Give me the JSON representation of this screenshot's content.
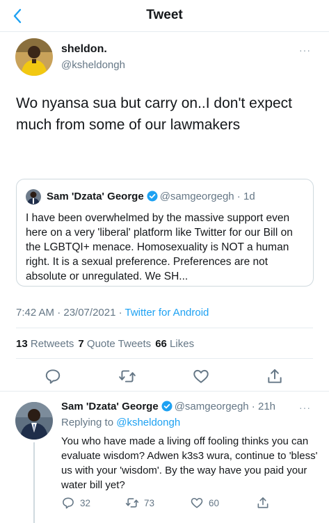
{
  "header": {
    "title": "Tweet"
  },
  "tweet": {
    "author_name": "sheldon.",
    "author_handle": "@ksheldongh",
    "text": "Wo nyansa sua but carry on..I don't expect much from some of our lawmakers",
    "timestamp": "7:42 AM · 23/07/2021 · ",
    "source": "Twitter for Android"
  },
  "quoted_tweet": {
    "author_name": "Sam 'Dzata' George",
    "author_handle": "@samgeorgegh · 1d",
    "text": "I have been overwhelmed by the massive support even here on a very 'liberal' platform like Twitter for our Bill on the LGBTQI+ menace. Homosexuality is NOT a human right. It is a sexual preference. Preferences are not absolute or unregulated. We SH..."
  },
  "stats": {
    "retweets_count": "13",
    "retweets_label": "Retweets",
    "quote_tweets_count": "7",
    "quote_tweets_label": "Quote Tweets",
    "likes_count": "66",
    "likes_label": "Likes"
  },
  "reply": {
    "author_name": "Sam 'Dzata' George",
    "author_handle": "@samgeorgegh · 21h",
    "replying_prefix": "Replying to ",
    "replying_to": "@ksheldongh",
    "text": "You who have made a living off fooling thinks you can evaluate wisdom? Adwen k3s3 wura, continue to 'bless' us with your 'wisdom'. By the way have you paid your water bill yet?",
    "reply_count": "32",
    "retweet_count": "73",
    "like_count": "60"
  },
  "more_glyph": "···",
  "colors": {
    "accent": "#1da1f2",
    "muted": "#657786",
    "border": "#e6ecf0"
  },
  "icons": [
    "back-chevron-icon",
    "verified-badge-icon",
    "reply-icon",
    "retweet-icon",
    "like-heart-icon",
    "share-icon",
    "more-icon"
  ]
}
